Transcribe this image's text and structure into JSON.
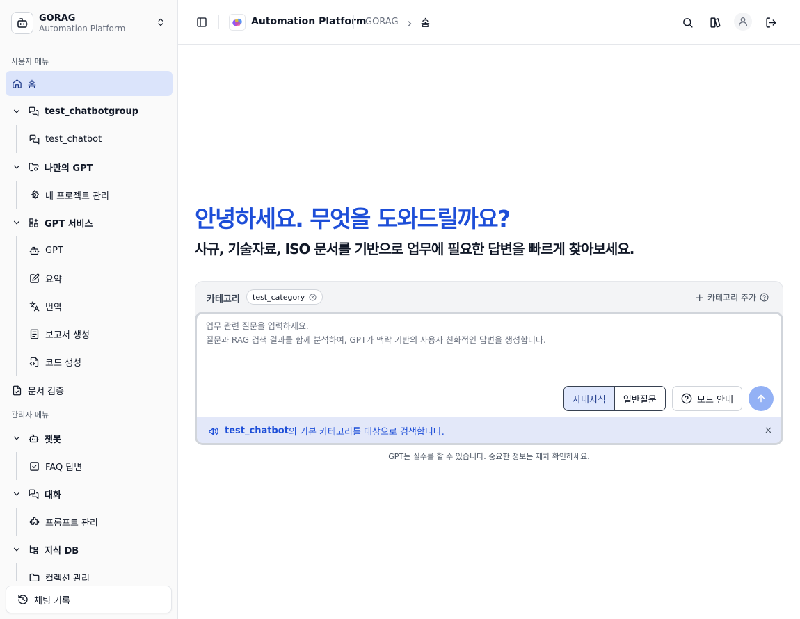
{
  "brand": {
    "name": "GORAG",
    "subtitle": "Automation Platform"
  },
  "sidebar": {
    "user_section_label": "사용자 메뉴",
    "admin_section_label": "관리자 메뉴",
    "home": "홈",
    "chatbotgroup": {
      "label": "test_chatbotgroup",
      "children": [
        "test_chatbot"
      ]
    },
    "my_gpt": {
      "label": "나만의 GPT",
      "children": [
        "내 프로젝트 관리"
      ]
    },
    "gpt_service": {
      "label": "GPT 서비스",
      "children": [
        "GPT",
        "요약",
        "번역",
        "보고서 생성",
        "코드 생성"
      ]
    },
    "doc_verify": "문서 검증",
    "chatbot": {
      "label": "챗봇",
      "children": [
        "FAQ 답변"
      ]
    },
    "conversation": {
      "label": "대화",
      "children": [
        "프롬프트 관리"
      ]
    },
    "knowledge_db": {
      "label": "지식 DB",
      "children": [
        "컬렉션 관리"
      ]
    },
    "history_button": "채팅 기록"
  },
  "header": {
    "app_title": "Automation Platform",
    "breadcrumb": [
      "GORAG",
      "홈"
    ]
  },
  "main": {
    "greeting": "안녕하세요. 무엇을 도와드릴까요?",
    "subtitle": "사규, 기술자료, ISO 문서를 기반으로 업무에 필요한 답변을 빠르게 찾아보세요.",
    "category_label": "카테고리",
    "category_chip": "test_category",
    "add_category": "카테고리 추가",
    "input_placeholder": "업무 관련 질문을 입력하세요.\n질문과 RAG 검색 결과를 함께 분석하여, GPT가 맥락 기반의 사용자 친화적인 답변을 생성합니다.",
    "mode_internal": "사내지식",
    "mode_general": "일반질문",
    "mode_selected": "사내지식",
    "mode_guide": "모드 안내",
    "notice_strong": "test_chatbot",
    "notice_rest": "의 기본 카테고리를 대상으로 검색합니다.",
    "disclaimer": "GPT는 실수를 할 수 있습니다. 중요한 정보는 재차 확인하세요."
  },
  "colors": {
    "accent": "#1d4ed8",
    "active_bg": "#dbe4fb",
    "send": "#93b1f5",
    "notice_bg": "#e3e8f9"
  },
  "icons": [
    "bot-icon",
    "chevrons-updown-icon",
    "home-icon",
    "chevron-down-icon",
    "chat-icon",
    "folder-icon",
    "gear-icon",
    "grid-plus-icon",
    "edit-icon",
    "translate-icon",
    "report-icon",
    "code-icon",
    "file-check-icon",
    "checkbox-icon",
    "puzzle-icon",
    "db-icon",
    "history-icon",
    "sidebar-toggle-icon",
    "search-icon",
    "book-icon",
    "user-icon",
    "logout-icon",
    "megaphone-icon",
    "close-icon",
    "help-circle-icon",
    "arrow-up-icon"
  ]
}
